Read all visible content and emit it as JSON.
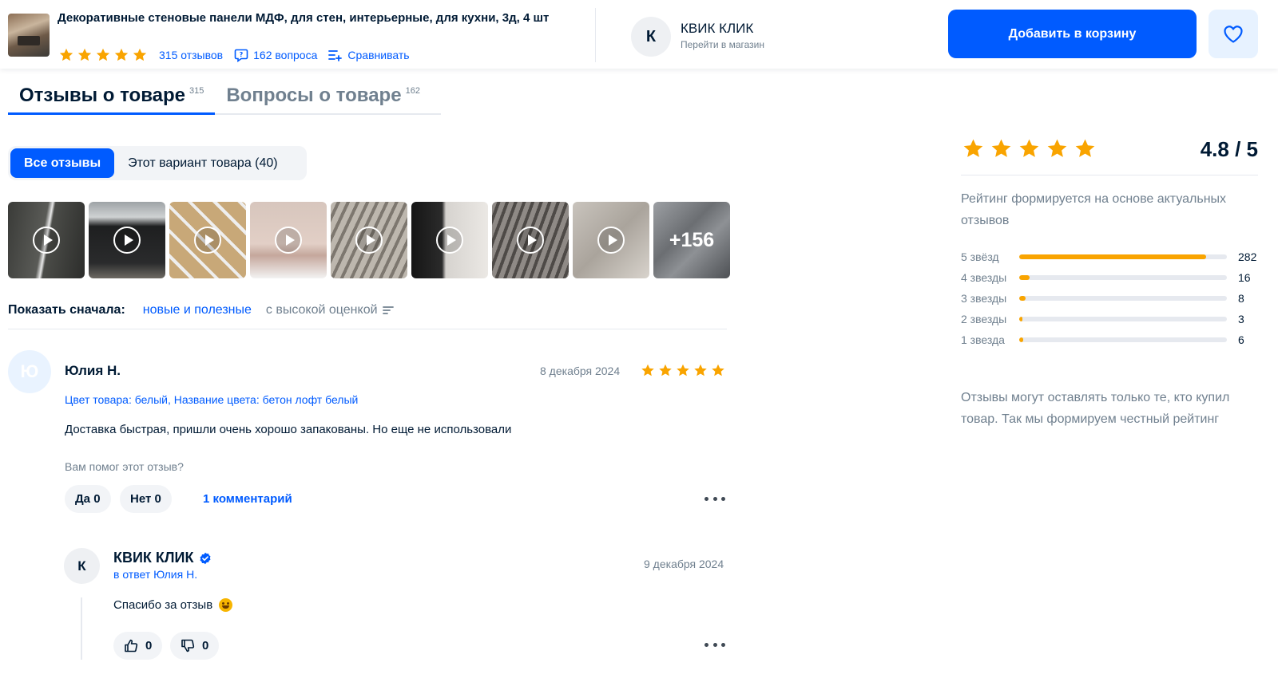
{
  "header": {
    "product_title": "Декоративные стеновые панели МДФ, для стен, интерьерные, для кухни, 3д, 4 шт",
    "rating_stars": 5,
    "reviews_link": "315 отзывов",
    "questions_link": "162 вопроса",
    "compare_link": "Сравнивать",
    "shop_initial": "К",
    "shop_name": "КВИК КЛИК",
    "shop_link": "Перейти в магазин",
    "cart_button": "Добавить в корзину",
    "favorite_icon": "heart-icon"
  },
  "tabs": [
    {
      "label": "Отзывы о товаре",
      "count": "315",
      "active": true
    },
    {
      "label": "Вопросы о товаре",
      "count": "162",
      "active": false
    }
  ],
  "filters": {
    "all": "Все отзывы",
    "variant": "Этот вариант товара (40)"
  },
  "gallery": {
    "items": [
      {
        "type": "video"
      },
      {
        "type": "video"
      },
      {
        "type": "video"
      },
      {
        "type": "video"
      },
      {
        "type": "video"
      },
      {
        "type": "video"
      },
      {
        "type": "video"
      },
      {
        "type": "video"
      },
      {
        "type": "more"
      }
    ],
    "more_label": "+156"
  },
  "sort": {
    "label": "Показать сначала:",
    "option_active": "новые и полезные",
    "option_other": "с высокой оценкой"
  },
  "review": {
    "avatar_initial": "Ю",
    "author": "Юлия Н.",
    "date": "8 декабря 2024",
    "stars": 5,
    "variant": "Цвет товара: белый, Название цвета: бетон лофт белый",
    "text": "Доставка быстрая, пришли очень хорошо запакованы. Но еще не использовали",
    "helpful_question": "Вам помог этот отзыв?",
    "yes_label": "Да",
    "yes_count": "0",
    "no_label": "Нет",
    "no_count": "0",
    "comments_link": "1 комментарий"
  },
  "reply": {
    "avatar_initial": "К",
    "author": "КВИК КЛИК",
    "to": "в ответ Юлия Н.",
    "date": "9 декабря 2024",
    "text": "Спасибо за отзыв",
    "likes": "0",
    "dislikes": "0"
  },
  "rating_panel": {
    "stars": 5,
    "score": "4.8 / 5",
    "note": "Рейтинг формируется на основе актуальных отзывов",
    "rows": [
      {
        "label": "5 звёзд",
        "count": "282",
        "share": 0.9
      },
      {
        "label": "4 звезды",
        "count": "16",
        "share": 0.05
      },
      {
        "label": "3 звезды",
        "count": "8",
        "share": 0.03
      },
      {
        "label": "2 звезды",
        "count": "3",
        "share": 0.01
      },
      {
        "label": "1 звезда",
        "count": "6",
        "share": 0.02
      }
    ],
    "footer": "Отзывы могут оставлять только те, кто купил товар. Так мы формируем честный рейтинг"
  },
  "colors": {
    "accent": "#005bff",
    "star": "#f9a400",
    "muted": "#70808f"
  }
}
